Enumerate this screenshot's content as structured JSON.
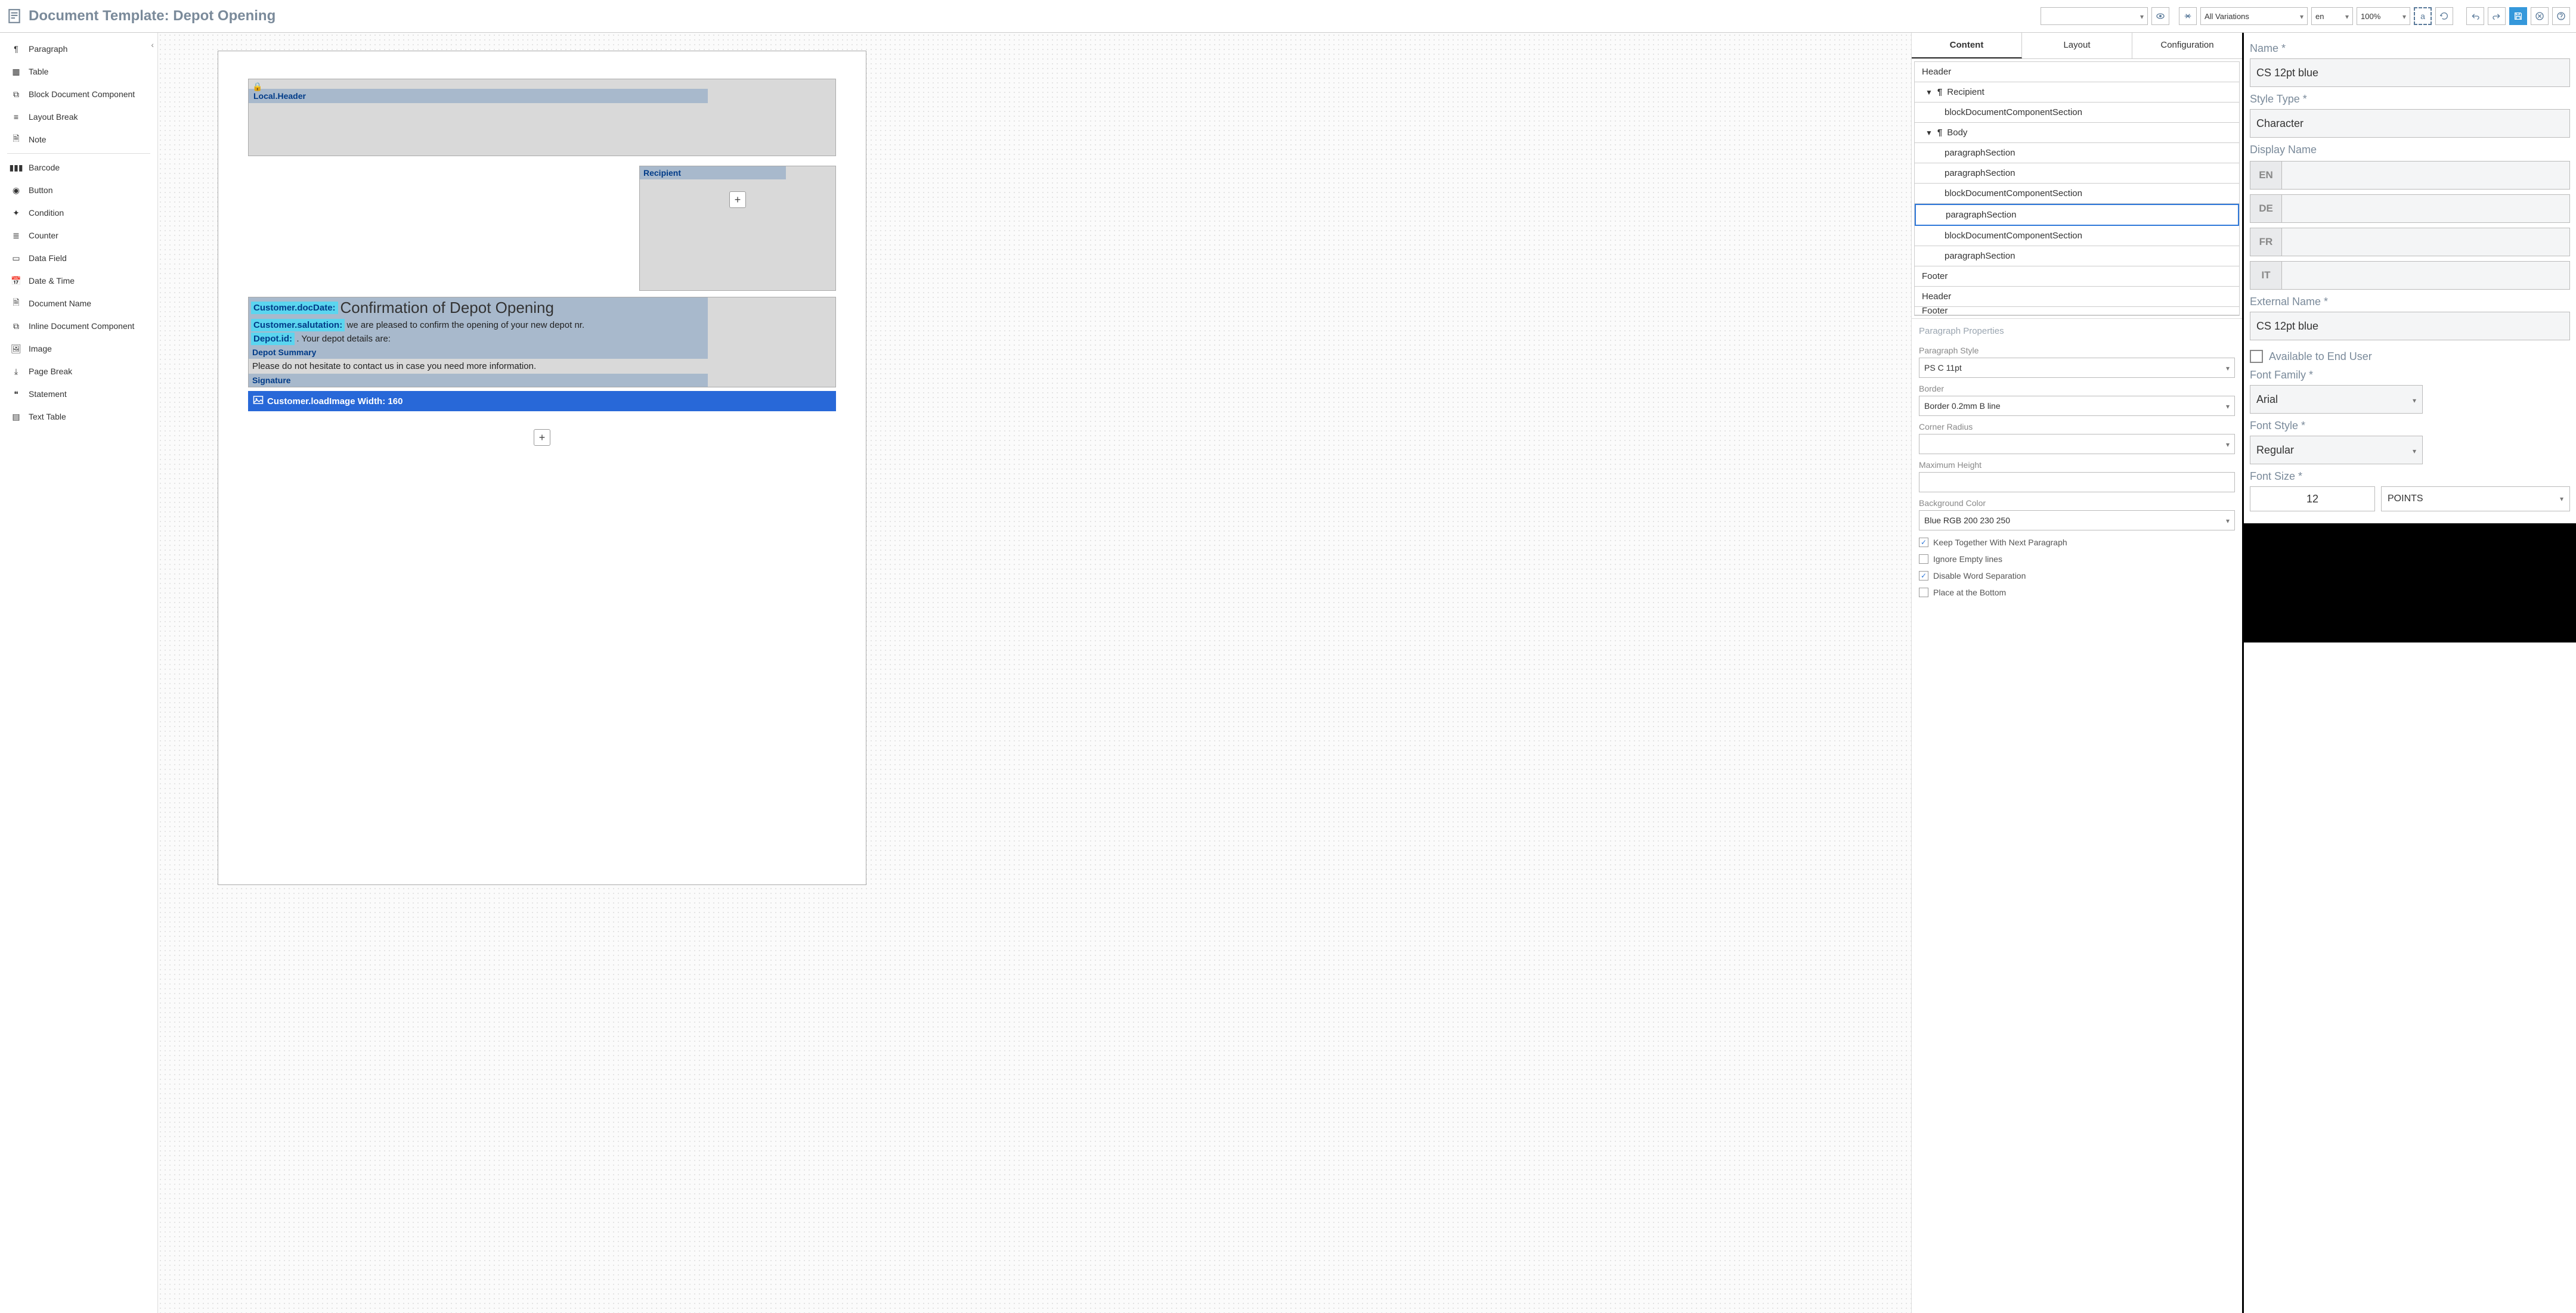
{
  "header": {
    "title": "Document Template: Depot Opening"
  },
  "toolbar": {
    "variation_label": "All Variations",
    "language": "en",
    "zoom": "100%"
  },
  "left_panel": {
    "items": [
      "Paragraph",
      "Table",
      "Block Document Component",
      "Layout Break",
      "Note",
      "_div",
      "Barcode",
      "Button",
      "Condition",
      "Counter",
      "Data Field",
      "Date & Time",
      "Document Name",
      "Inline Document Component",
      "Image",
      "Page Break",
      "Statement",
      "Text Table"
    ]
  },
  "canvas": {
    "local_header": "Local.Header",
    "recipient_label": "Recipient",
    "doc_date_field": "Customer.docDate:",
    "doc_title": "Confirmation of Depot Opening",
    "salutation_field": "Customer.salutation:",
    "body_line1": "we are pleased to confirm the opening of your new depot nr.",
    "depot_id_field": "Depot.id:",
    "body_line2": ". Your depot details are:",
    "depot_summary": "Depot Summary",
    "body_para2": "Please do not hesitate to contact us in case you need more information.",
    "signature": "Signature",
    "image_bar": "Customer.loadImage Width: 160"
  },
  "content_panel": {
    "tabs": {
      "content": "Content",
      "layout": "Layout",
      "configuration": "Configuration"
    },
    "tree": [
      {
        "label": "Header",
        "lev": 0
      },
      {
        "label": "Recipient",
        "lev": 1,
        "expandable": true
      },
      {
        "label": "blockDocumentComponentSection",
        "lev": 2
      },
      {
        "label": "Body",
        "lev": 1,
        "expandable": true
      },
      {
        "label": "paragraphSection",
        "lev": 2
      },
      {
        "label": "paragraphSection",
        "lev": 2
      },
      {
        "label": "blockDocumentComponentSection",
        "lev": 2
      },
      {
        "label": "paragraphSection",
        "lev": 2,
        "selected": true
      },
      {
        "label": "blockDocumentComponentSection",
        "lev": 2
      },
      {
        "label": "paragraphSection",
        "lev": 2
      },
      {
        "label": "Footer",
        "lev": 0
      },
      {
        "label": "Header",
        "lev": 0
      },
      {
        "label": "Footer",
        "lev": 0,
        "cut": true
      }
    ],
    "props": {
      "heading": "Paragraph Properties",
      "paragraph_style_label": "Paragraph Style",
      "paragraph_style_value": "PS C 11pt",
      "border_label": "Border",
      "border_value": "Border 0.2mm B line",
      "corner_radius_label": "Corner Radius",
      "corner_radius_value": "",
      "max_height_label": "Maximum Height",
      "max_height_value": "",
      "bg_color_label": "Background Color",
      "bg_color_value": "Blue RGB 200 230 250",
      "keep_together": "Keep Together With Next Paragraph",
      "ignore_empty": "Ignore Empty lines",
      "disable_word_sep": "Disable Word Separation",
      "place_bottom": "Place at the Bottom"
    }
  },
  "right_panel": {
    "name_label": "Name *",
    "name_value": "CS 12pt blue",
    "style_type_label": "Style Type *",
    "style_type_value": "Character",
    "display_name_label": "Display Name",
    "langs": [
      "EN",
      "DE",
      "FR",
      "IT"
    ],
    "external_name_label": "External Name *",
    "external_name_value": "CS 12pt blue",
    "available_label": "Available to End User",
    "font_family_label": "Font Family *",
    "font_family_value": "Arial",
    "font_style_label": "Font Style *",
    "font_style_value": "Regular",
    "font_size_label": "Font Size *",
    "font_size_value": "12",
    "font_size_unit": "POINTS"
  }
}
